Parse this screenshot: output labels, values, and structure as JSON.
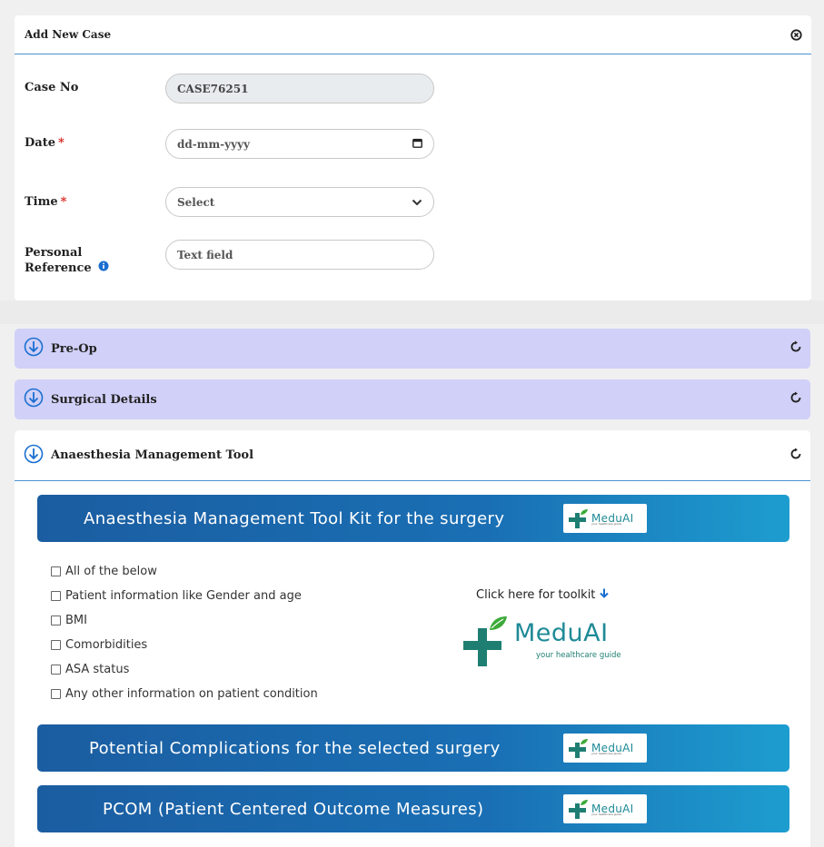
{
  "modal": {
    "title": "Add New Case",
    "close_icon": "close-circle-icon"
  },
  "form": {
    "case_no": {
      "label": "Case No",
      "value": "CASE76251"
    },
    "date": {
      "label": "Date",
      "required_mark": "*",
      "placeholder": "dd-mm-yyyy",
      "icon": "calendar-icon"
    },
    "time": {
      "label": "Time",
      "required_mark": "*",
      "value": "Select",
      "icon": "chevron-down-icon"
    },
    "personal_reference": {
      "label_line1": "Personal",
      "label_line2": "Reference",
      "placeholder": "Text field",
      "icon": "info-icon"
    }
  },
  "accordions": [
    {
      "label": "Pre-Op",
      "expand_icon": "arrow-down-circle-icon",
      "reset_icon": "refresh-icon"
    },
    {
      "label": "Surgical Details",
      "expand_icon": "arrow-down-circle-icon",
      "reset_icon": "refresh-icon"
    },
    {
      "label": "Anaesthesia Management Tool",
      "expand_icon": "arrow-down-circle-icon",
      "reset_icon": "refresh-icon"
    }
  ],
  "tool": {
    "banners": [
      {
        "text": "Anaesthesia Management Tool Kit for the surgery"
      },
      {
        "text": "Potential Complications for the selected surgery"
      },
      {
        "text": "PCOM (Patient Centered Outcome Measures)"
      }
    ],
    "checkboxes": [
      {
        "label": "All of the below",
        "checked": false
      },
      {
        "label": "Patient information like Gender and age",
        "checked": false
      },
      {
        "label": "BMI",
        "checked": false
      },
      {
        "label": "Comorbidities",
        "checked": false
      },
      {
        "label": "ASA status",
        "checked": false
      },
      {
        "label": "Any other information on patient condition",
        "checked": false
      }
    ],
    "toolkit_link": "Click here for toolkit",
    "logo": {
      "word": "MeduAI",
      "tagline": "your healthcare guide"
    }
  },
  "colors": {
    "accordion_bg": "#d0d0f8",
    "banner_start": "#1b5da1",
    "banner_end": "#1d9dd0",
    "required": "#d9221c",
    "logo_green": "#2e9e4a",
    "logo_teal": "#1e8a96"
  }
}
